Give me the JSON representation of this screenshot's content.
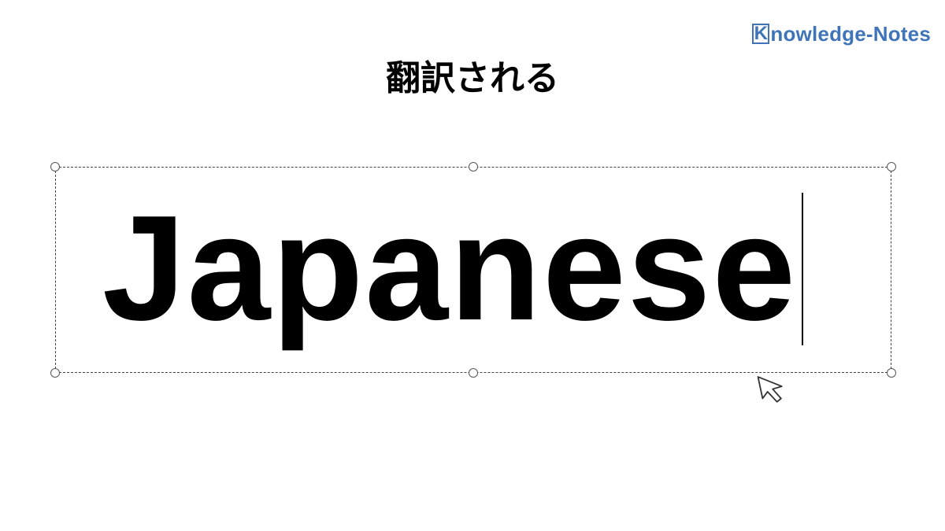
{
  "brand": {
    "initial": "K",
    "rest": "nowledge-Notes",
    "color": "#3f74b9"
  },
  "slide": {
    "title": "翻訳される"
  },
  "textbox": {
    "text": "Japanese"
  },
  "cursor": {
    "icon": "arrow-pointer-icon"
  }
}
